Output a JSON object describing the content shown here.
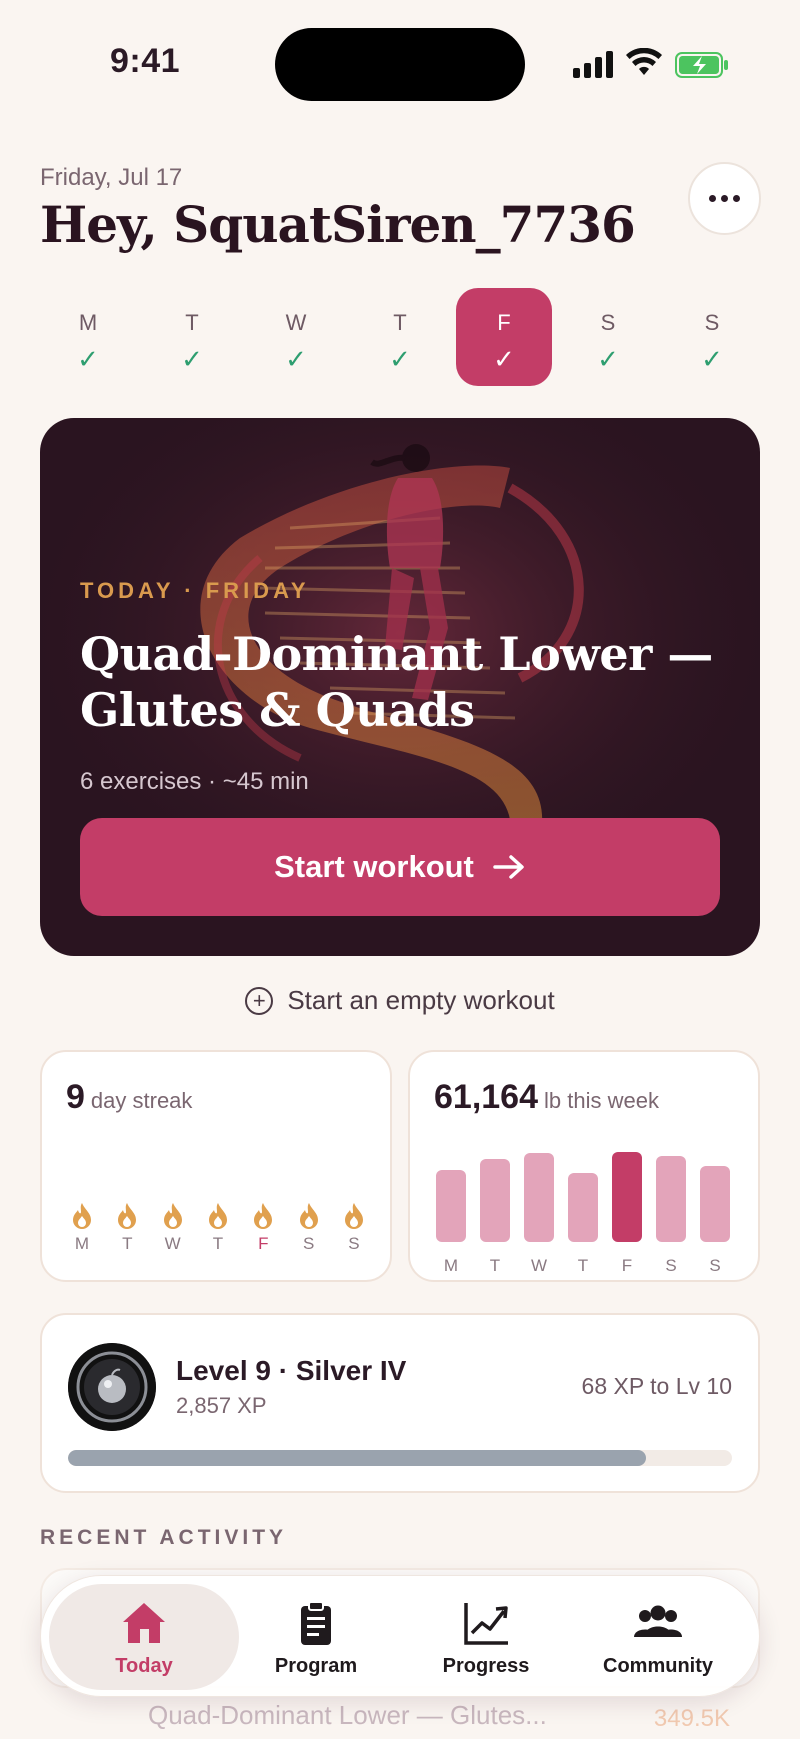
{
  "status_bar": {
    "time": "9:41"
  },
  "header": {
    "date": "Friday, Jul 17",
    "greeting": "Hey, SquatSiren_7736",
    "more_icon": "more-horizontal-icon"
  },
  "week": [
    {
      "label": "M",
      "done": true,
      "active": false
    },
    {
      "label": "T",
      "done": true,
      "active": false
    },
    {
      "label": "W",
      "done": true,
      "active": false
    },
    {
      "label": "T",
      "done": true,
      "active": false
    },
    {
      "label": "F",
      "done": true,
      "active": true
    },
    {
      "label": "S",
      "done": true,
      "active": false
    },
    {
      "label": "S",
      "done": true,
      "active": false
    }
  ],
  "check_glyph": "✓",
  "hero": {
    "tag": "TODAY · FRIDAY",
    "title": "Quad-Dominant Lower — Glutes & Quads",
    "meta": "6 exercises · ~45 min",
    "button_label": "Start workout",
    "button_icon": "arrow-right-icon"
  },
  "empty_workout": {
    "label": "Start an empty workout",
    "icon": "plus-circle-icon"
  },
  "streak": {
    "value": "9",
    "unit": "day streak",
    "days": [
      "M",
      "T",
      "W",
      "T",
      "F",
      "S",
      "S"
    ],
    "highlight_index": 4
  },
  "volume": {
    "value": "61,164",
    "unit": "lb this week",
    "days": [
      "M",
      "T",
      "W",
      "T",
      "F",
      "S",
      "S"
    ],
    "relative_levels": [
      0.72,
      0.83,
      0.89,
      0.69,
      0.9,
      0.86,
      0.76
    ],
    "highlight_index": 4
  },
  "level": {
    "title": "Level 9 · Silver IV",
    "xp": "2,857 XP",
    "next": "68 XP to Lv 10",
    "progress": 0.87
  },
  "recent": {
    "heading": "RECENT ACTIVITY",
    "items": [
      {
        "title": "Quad-Dominant Lower — Glutes...",
        "value": "349.5K"
      }
    ]
  },
  "tabs": [
    {
      "label": "Today",
      "icon": "home-icon",
      "active": true
    },
    {
      "label": "Program",
      "icon": "clipboard-icon",
      "active": false
    },
    {
      "label": "Progress",
      "icon": "chart-line-icon",
      "active": false
    },
    {
      "label": "Community",
      "icon": "people-icon",
      "active": false
    }
  ],
  "colors": {
    "accent": "#c33d67",
    "accent_light": "#e3a4ba",
    "check_green": "#2e9e70",
    "flame": "#e0a04e",
    "hero_bg": "#2a1420",
    "background": "#faf5f1"
  }
}
